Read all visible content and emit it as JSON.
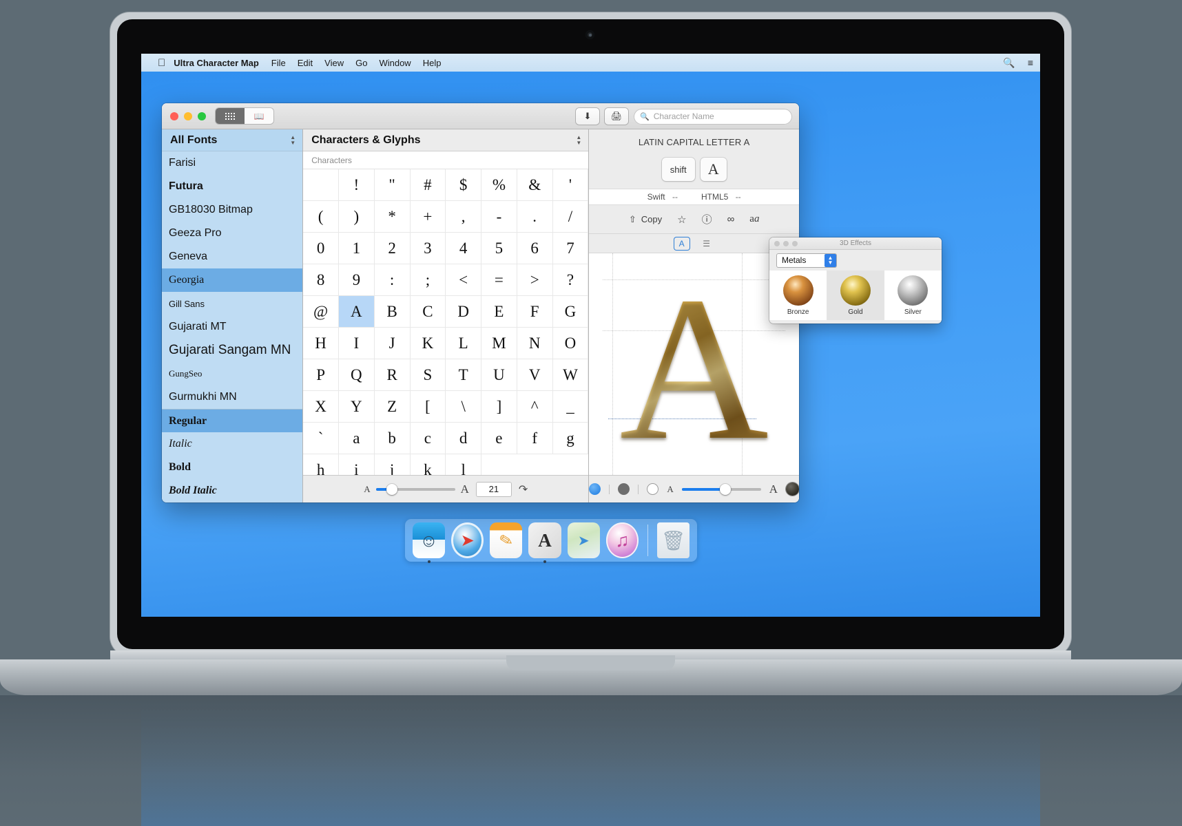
{
  "menubar": {
    "apple_icon": "apple-icon",
    "app_name": "Ultra Character Map",
    "items": [
      "File",
      "Edit",
      "View",
      "Go",
      "Window",
      "Help"
    ],
    "right_icons": [
      "search-icon",
      "list-icon"
    ]
  },
  "window": {
    "segments": [
      {
        "name": "grid-view",
        "icon": "grid-icon",
        "active": true
      },
      {
        "name": "book-view",
        "icon": "book-icon",
        "active": false
      }
    ],
    "toolbar": {
      "download_icon": "download-icon",
      "print_icon": "print-icon"
    },
    "search": {
      "placeholder": "Character Name",
      "value": "",
      "icon": "search-icon"
    }
  },
  "sidebar": {
    "title": "All Fonts",
    "fonts": [
      {
        "label": "Farisi",
        "style": "sans",
        "size": "norm",
        "selected": false
      },
      {
        "label": "Futura",
        "style": "sans",
        "size": "norm",
        "selected": false,
        "bold": true
      },
      {
        "label": "GB18030 Bitmap",
        "style": "sans",
        "size": "norm",
        "selected": false
      },
      {
        "label": "Geeza Pro",
        "style": "sans",
        "size": "norm",
        "selected": false
      },
      {
        "label": "Geneva",
        "style": "sans",
        "size": "norm",
        "selected": false
      },
      {
        "label": "Georgia",
        "style": "serif",
        "size": "norm",
        "selected": true
      },
      {
        "label": "Gill Sans",
        "style": "sans",
        "size": "small",
        "selected": false
      },
      {
        "label": "Gujarati MT",
        "style": "sans",
        "size": "norm",
        "selected": false
      },
      {
        "label": "Gujarati Sangam MN",
        "style": "sans",
        "size": "big",
        "selected": false
      },
      {
        "label": "GungSeo",
        "style": "serif",
        "size": "small",
        "selected": false
      },
      {
        "label": "Gurmukhi MN",
        "style": "sans",
        "size": "norm",
        "selected": false
      }
    ],
    "faces": [
      {
        "label": "Regular",
        "style": "serif",
        "selected": true,
        "bold": false,
        "italic": false
      },
      {
        "label": "Italic",
        "style": "serif",
        "selected": false,
        "bold": false,
        "italic": true
      },
      {
        "label": "Bold",
        "style": "serif",
        "selected": false,
        "bold": true,
        "italic": false
      },
      {
        "label": "Bold Italic",
        "style": "serif",
        "selected": false,
        "bold": true,
        "italic": true
      }
    ]
  },
  "center": {
    "title": "Characters & Glyphs",
    "section_label": "Characters",
    "columns": 8,
    "selected_char": "A",
    "grid": [
      " ",
      "!",
      "\"",
      "#",
      "$",
      "%",
      "&",
      "'",
      "(",
      ")",
      "*",
      "+",
      ",",
      "-",
      ".",
      "/",
      "0",
      "1",
      "2",
      "3",
      "4",
      "5",
      "6",
      "7",
      "8",
      "9",
      ":",
      ";",
      "<",
      "=",
      ">",
      "?",
      "@",
      "A",
      "B",
      "C",
      "D",
      "E",
      "F",
      "G",
      "H",
      "I",
      "J",
      "K",
      "L",
      "M",
      "N",
      "O",
      "P",
      "Q",
      "R",
      "S",
      "T",
      "U",
      "V",
      "W",
      "X",
      "Y",
      "Z",
      "[",
      "\\",
      "]",
      "^",
      "_",
      "`",
      "a",
      "b",
      "c",
      "d",
      "e",
      "f",
      "g",
      "h",
      "i",
      "j",
      "k",
      "l"
    ],
    "footer": {
      "small_a": "A",
      "large_a": "A",
      "size_value": "21",
      "slider_percent": 20,
      "reset_icon": "reset-arrow-icon"
    }
  },
  "preview": {
    "character_name": "LATIN CAPITAL LETTER A",
    "keys": [
      {
        "label": "shift",
        "type": "modifier"
      },
      {
        "label": "A",
        "type": "letter"
      }
    ],
    "codes": [
      {
        "label": "Swift",
        "value": "--"
      },
      {
        "label": "HTML5",
        "value": "--"
      }
    ],
    "actions": {
      "share_icon": "share-icon",
      "copy_label": "Copy",
      "favorite_icon": "star-icon",
      "info_icon": "info-icon",
      "network_icon": "share-network-icon",
      "font_icon": "font-variants-icon"
    },
    "tabs": [
      {
        "name": "glyph-tab",
        "icon": "boxed-A-icon",
        "active": true
      },
      {
        "name": "text-tab",
        "icon": "lines-icon",
        "active": false
      }
    ],
    "glyph": "A",
    "glyph_gradient": "#c8a046",
    "footer": {
      "backgrounds": [
        {
          "name": "blue-bg",
          "color": "#1a7ae0",
          "selected": true
        },
        {
          "name": "dark-bg",
          "color": "#6e6e6e",
          "selected": false
        },
        {
          "name": "white-bg",
          "color": "#ffffff",
          "selected": false
        }
      ],
      "small_a": "A",
      "large_a": "A",
      "slider_percent": 55,
      "effect_swatch": "metal-3d-swatch"
    }
  },
  "fx_panel": {
    "title": "3D Effects",
    "category": "Metals",
    "items": [
      {
        "label": "Bronze",
        "color": "#a96a33",
        "selected": false
      },
      {
        "label": "Gold",
        "color": "#c8a63a",
        "selected": true
      },
      {
        "label": "Silver",
        "color": "#b5b5b5",
        "selected": false
      }
    ]
  },
  "dock": {
    "items": [
      {
        "name": "finder",
        "label": "Finder",
        "running": true
      },
      {
        "name": "safari",
        "label": "Safari",
        "running": false
      },
      {
        "name": "pages",
        "label": "Pages",
        "running": false
      },
      {
        "name": "fontbook",
        "label": "Font Book",
        "running": true
      },
      {
        "name": "maps",
        "label": "Maps",
        "running": false
      },
      {
        "name": "itunes",
        "label": "iTunes",
        "running": false
      },
      {
        "name": "trash",
        "label": "Trash",
        "running": false
      }
    ]
  }
}
